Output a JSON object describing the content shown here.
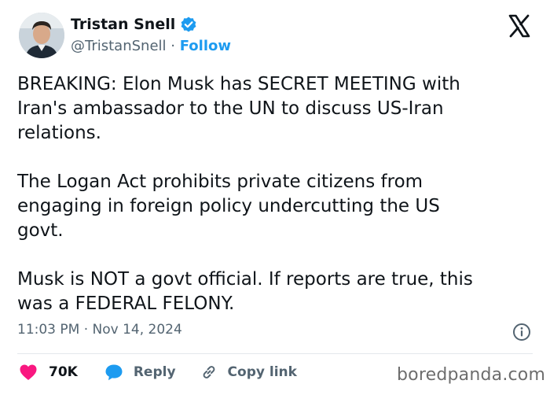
{
  "author": {
    "name": "Tristan Snell",
    "handle": "@TristanSnell",
    "follow_label": "Follow"
  },
  "tweet": {
    "text": "BREAKING: Elon Musk has SECRET MEETING with\nIran's ambassador to the UN to discuss US-Iran\nrelations.\n\nThe Logan Act prohibits private citizens from\nengaging in foreign policy undercutting the US\ngovt.\n\nMusk is NOT a govt official. If reports are true, this\nwas a FEDERAL FELONY.",
    "timestamp": "11:03 PM · Nov 14, 2024"
  },
  "actions": {
    "like_count": "70K",
    "reply_label": "Reply",
    "copy_label": "Copy link"
  },
  "watermark": "boredpanda.com",
  "colors": {
    "accent": "#1d9bf0",
    "like": "#f91880",
    "text": "#0f1419",
    "muted": "#536471"
  },
  "icons": [
    "verified-badge-icon",
    "x-logo-icon",
    "info-icon",
    "heart-icon",
    "reply-bubble-icon",
    "link-icon"
  ]
}
